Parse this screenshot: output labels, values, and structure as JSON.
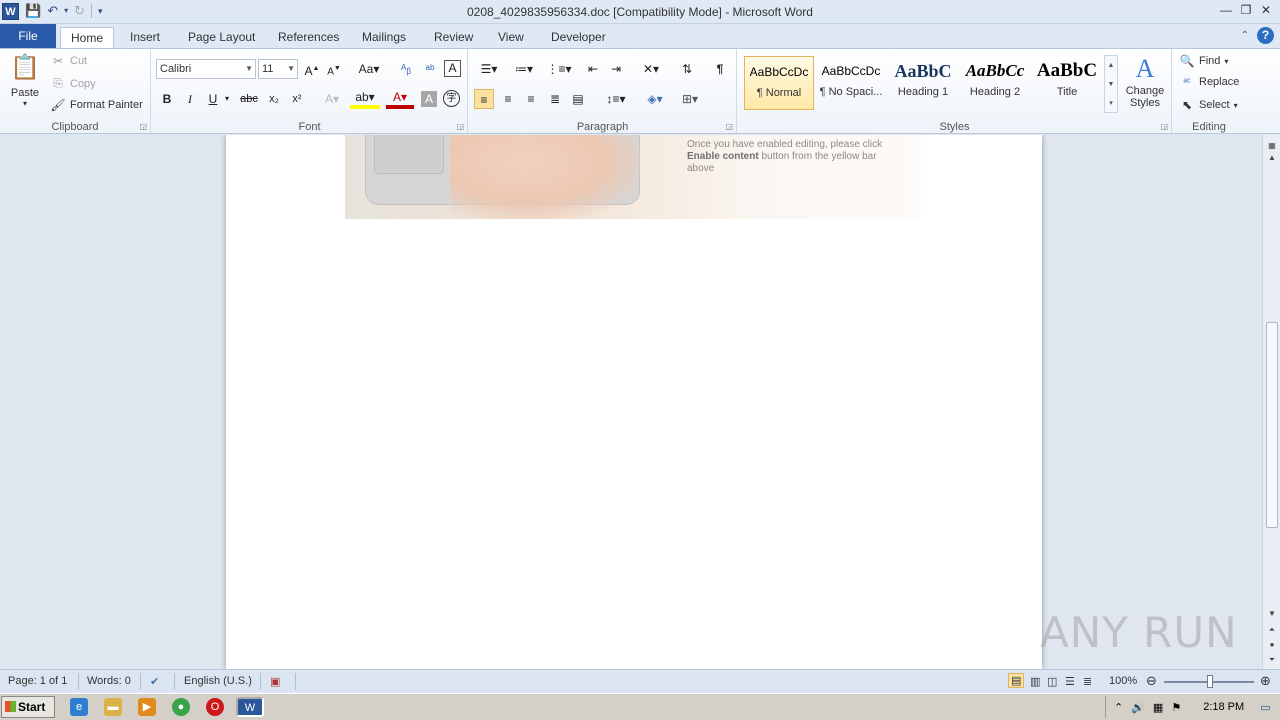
{
  "window": {
    "title": "0208_4029835956334.doc [Compatibility Mode]  -  Microsoft Word",
    "controls": [
      "—",
      "❐",
      "✕"
    ]
  },
  "tabs": [
    {
      "label": "File"
    },
    {
      "label": "Home"
    },
    {
      "label": "Insert"
    },
    {
      "label": "Page Layout"
    },
    {
      "label": "References"
    },
    {
      "label": "Mailings"
    },
    {
      "label": "Review"
    },
    {
      "label": "View"
    },
    {
      "label": "Developer"
    }
  ],
  "clipboard": {
    "paste": "Paste",
    "cut": "Cut",
    "copy": "Copy",
    "format_painter": "Format Painter",
    "label": "Clipboard"
  },
  "font": {
    "name": "Calibri",
    "size": "11",
    "label": "Font"
  },
  "paragraph": {
    "label": "Paragraph"
  },
  "styles": {
    "items": [
      {
        "sample": "AaBbCcDc",
        "name": "¶ Normal"
      },
      {
        "sample": "AaBbCcDc",
        "name": "¶ No Spaci..."
      },
      {
        "sample": "AaBbC",
        "name": "Heading 1"
      },
      {
        "sample": "AaBbCc",
        "name": "Heading 2"
      },
      {
        "sample": "AaBbC",
        "name": "Title"
      }
    ],
    "change_styles": "Change Styles",
    "label": "Styles"
  },
  "editing": {
    "find": "Find",
    "replace": "Replace",
    "select": "Select",
    "label": "Editing"
  },
  "document": {
    "line1": "Once you have enabled editing, please click",
    "bold": "Enable content",
    "line2_rest": " button from the yellow bar",
    "line3": "above"
  },
  "status": {
    "page": "Page: 1 of 1",
    "words": "Words: 0",
    "language": "English (U.S.)",
    "zoom": "100%"
  },
  "taskbar": {
    "start": "Start",
    "time": "2:18 PM"
  },
  "watermark": "ANY RUN"
}
